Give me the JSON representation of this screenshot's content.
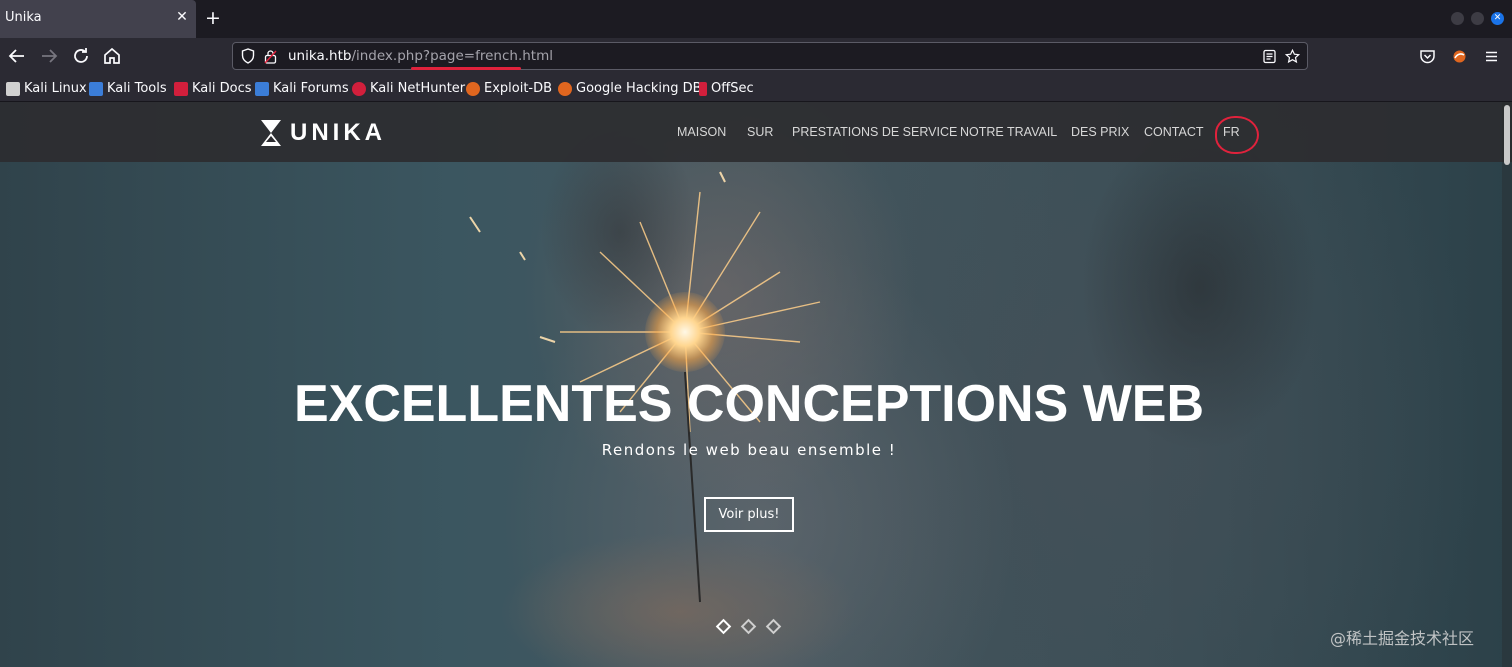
{
  "browser": {
    "tab": {
      "title": "Unika"
    },
    "url": {
      "host": "unika.htb",
      "path": "/index.php?page=french.html"
    },
    "bookmarks": [
      {
        "label": "Kali Linux",
        "icon": "kali-icon",
        "color": "#d0d0d0"
      },
      {
        "label": "Kali Tools",
        "icon": "kali-tools-icon",
        "color": "#3b7dd8"
      },
      {
        "label": "Kali Docs",
        "icon": "kali-docs-icon",
        "color": "#d21f3c"
      },
      {
        "label": "Kali Forums",
        "icon": "kali-forums-icon",
        "color": "#3b7dd8"
      },
      {
        "label": "Kali NetHunter",
        "icon": "nethunter-icon",
        "color": "#d21f3c"
      },
      {
        "label": "Exploit-DB",
        "icon": "exploitdb-icon",
        "color": "#e0661f"
      },
      {
        "label": "Google Hacking DB",
        "icon": "ghdb-icon",
        "color": "#e0661f"
      },
      {
        "label": "OffSec",
        "icon": "offsec-icon",
        "color": "#d21f3c"
      }
    ],
    "accent_color": "#e0223c"
  },
  "site": {
    "logo_text": "UNIKA",
    "menu": [
      "MAISON",
      "SUR",
      "PRESTATIONS DE SERVICE",
      "NOTRE TRAVAIL",
      "DES PRIX",
      "CONTACT",
      "FR"
    ],
    "hero": {
      "title": "EXCELLENTES CONCEPTIONS WEB",
      "subtitle": "Rendons le web beau ensemble !",
      "button": "Voir plus!"
    },
    "slider": {
      "slides": 3,
      "active": 1
    }
  },
  "watermark": "@稀土掘金技术社区"
}
